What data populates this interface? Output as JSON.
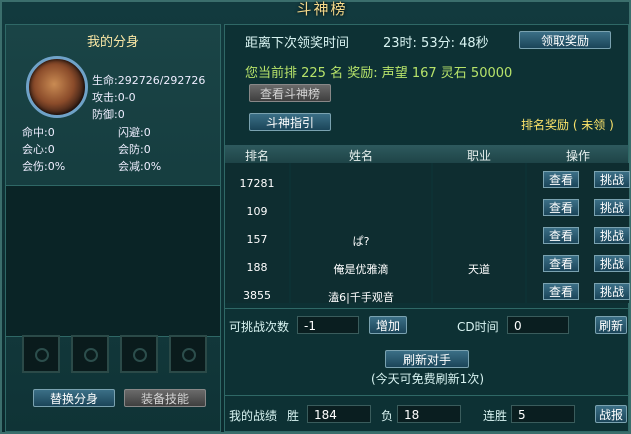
{
  "window": {
    "title": "斗神榜"
  },
  "left": {
    "title": "我的分身",
    "life_label": "生命:",
    "life_value": "292726/292726",
    "attack_label": "攻击:",
    "attack_value": "0-0",
    "defense_label": "防御:",
    "defense_value": "0",
    "hit_label": "命中:",
    "hit_value": "0",
    "dodge_label": "闪避:",
    "dodge_value": "0",
    "crit_label": "会心:",
    "crit_value": "0",
    "critdef_label": "会防:",
    "critdef_value": "0",
    "critdmg_label": "会伤:",
    "critdmg_value": "0%",
    "critred_label": "会减:",
    "critred_value": "0%",
    "swap_button": "替换分身",
    "equip_skill_button": "装备技能"
  },
  "reward": {
    "countdown_label": "距离下次领奖时间",
    "countdown_value": "23时: 53分: 48秒",
    "claim_button": "领取奖励",
    "rank_line": "您当前排  225  名  奖励:  声望  167  灵石  50000",
    "view_ranking_button": "查看斗神榜",
    "guide_button": "斗神指引",
    "rank_reward_status": "排名奖励 ( 未领 )"
  },
  "table": {
    "headers": [
      "排名",
      "姓名",
      "职业",
      "操作"
    ],
    "view_label": "查看",
    "challenge_label": "挑战",
    "rows": [
      {
        "rank": "17281",
        "name": "",
        "job": ""
      },
      {
        "rank": "109",
        "name": "",
        "job": ""
      },
      {
        "rank": "157",
        "name": "ぱ?",
        "job": ""
      },
      {
        "rank": "188",
        "name": "俺是优雅滴",
        "job": "天道"
      },
      {
        "rank": "3855",
        "name": "溘6|千手观音",
        "job": ""
      }
    ]
  },
  "controls": {
    "challenges_label": "可挑战次数",
    "challenges_value": "-1",
    "add_button": "增加",
    "cd_label": "CD时间",
    "cd_value": "0",
    "refresh_button": "刷新",
    "refresh_opponent_button": "刷新对手",
    "free_refresh_note": "(今天可免费刷新1次)"
  },
  "record": {
    "label": "我的战绩",
    "win_label": "胜",
    "win_value": "184",
    "lose_label": "负",
    "lose_value": "18",
    "streak_label": "连胜",
    "streak_value": "5",
    "report_button": "战报"
  },
  "colors": {
    "gold": "#f4d98a",
    "cyan": "#d9f4f2",
    "green": "#b7e36a",
    "yellow": "#fbe36a"
  }
}
